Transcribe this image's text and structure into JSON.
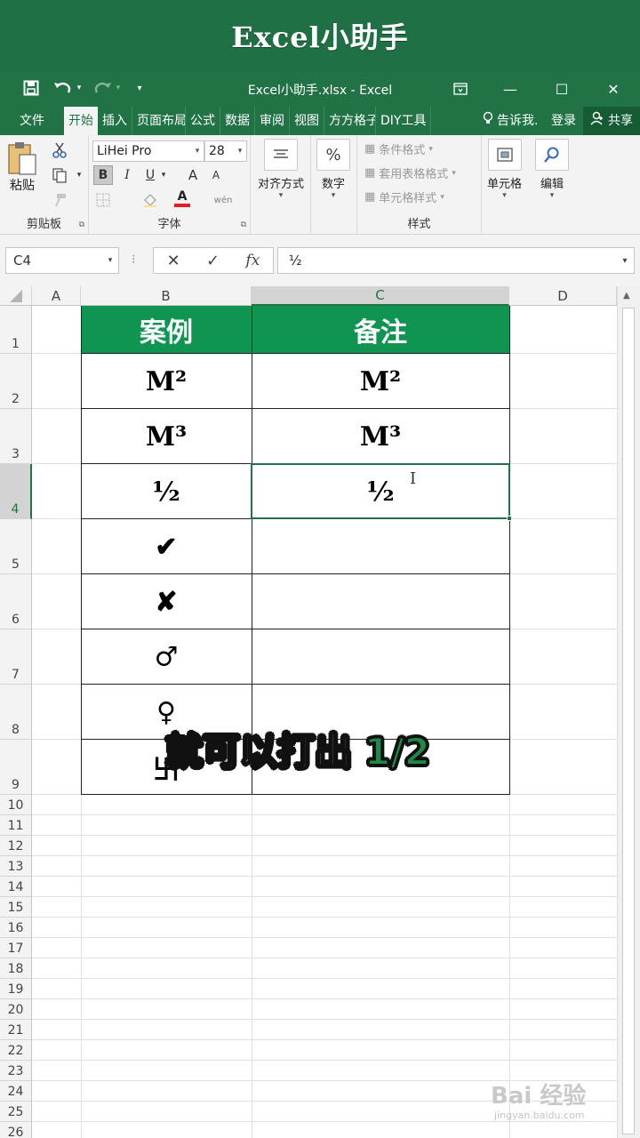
{
  "banner": {
    "title": "Excel小助手"
  },
  "window": {
    "filename": "Excel小助手.xlsx  -  Excel",
    "minimize": "—",
    "maximize": "☐",
    "close": "✕",
    "ribbon_display": "⧉"
  },
  "qat": {
    "save": "💾",
    "undo": "↶",
    "redo": "↷",
    "customize": "▾"
  },
  "tabs": [
    "文件",
    "开始",
    "插入",
    "页面布局",
    "公式",
    "数据",
    "审阅",
    "视图",
    "方方格子",
    "DIY工具"
  ],
  "active_tab": "开始",
  "tell_me": "告诉我...",
  "login": "登录",
  "share": "共享",
  "ribbon": {
    "clipboard": {
      "label": "剪贴板",
      "paste": "粘贴"
    },
    "font": {
      "label": "字体",
      "name": "LiHei Pro",
      "size": "28",
      "bold": "B",
      "italic": "I",
      "underline": "U",
      "grow": "A",
      "shrink": "A",
      "font_color": "A",
      "phonetic": "wén"
    },
    "alignment": {
      "label": "对齐方式"
    },
    "number": {
      "label": "数字"
    },
    "styles": {
      "label": "样式",
      "conditional": "条件格式",
      "table": "套用表格格式",
      "cell_styles": "单元格样式"
    },
    "cells": {
      "label": "单元格"
    },
    "editing": {
      "label": "编辑"
    }
  },
  "formula_bar": {
    "name_box": "C4",
    "cancel": "✕",
    "enter": "✓",
    "fx": "fx",
    "value": "½"
  },
  "sheet": {
    "columns": [
      "A",
      "B",
      "C",
      "D"
    ],
    "rows": [
      "1",
      "2",
      "3",
      "4",
      "5",
      "6",
      "7",
      "8",
      "9",
      "10",
      "11",
      "12",
      "13",
      "14",
      "15",
      "16",
      "17",
      "18",
      "19",
      "20",
      "21",
      "22",
      "23",
      "24",
      "25",
      "26"
    ],
    "header_b": "案例",
    "header_c": "备注",
    "col_b": [
      "M²",
      "M³",
      "½",
      "✔",
      "✘",
      "♂",
      "♀",
      "卐"
    ],
    "col_c": [
      "M²",
      "M³",
      "½",
      "",
      "",
      "",
      "",
      ""
    ]
  },
  "overlay": {
    "caption": "就可以打出",
    "highlight": "1/2"
  },
  "watermark": {
    "main": "Bai 经验",
    "sub": "jingyan.baidu.com"
  },
  "colors": {
    "excel_green": "#217346",
    "header_green": "#0f9551",
    "banner": "#1f7145"
  }
}
